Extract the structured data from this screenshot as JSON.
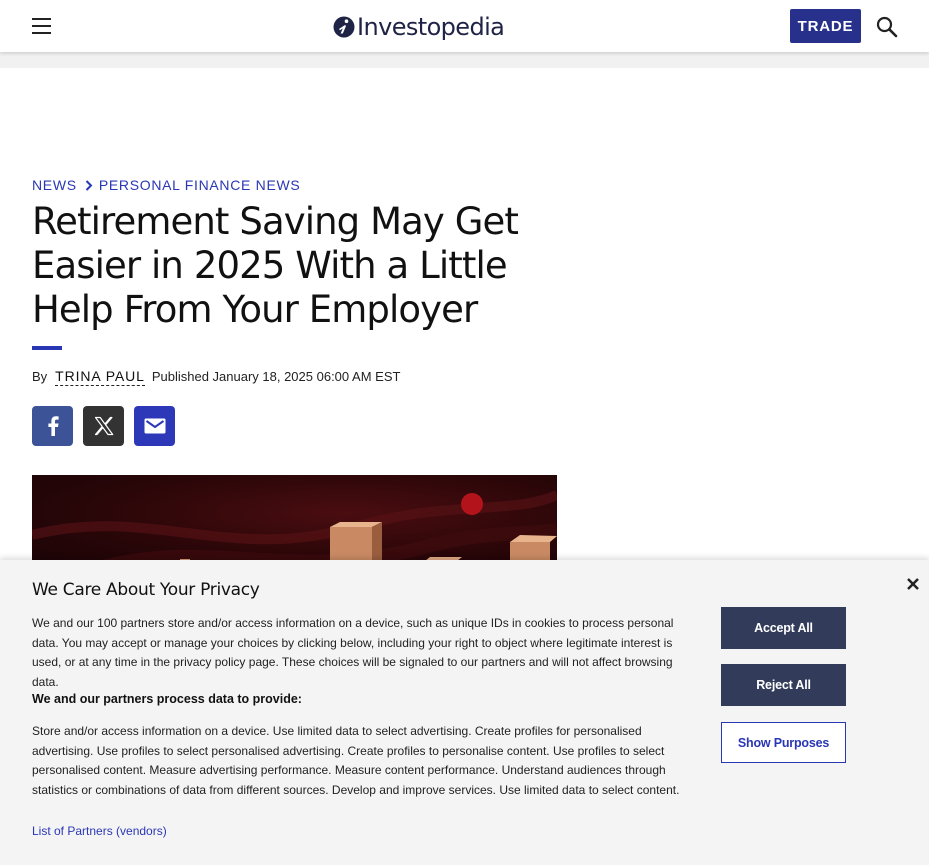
{
  "header": {
    "menu_icon": "hamburger-menu-icon",
    "logo_text": "Investopedia",
    "logo_icon": "investopedia-i-logo-icon",
    "trade_label": "TRADE",
    "search_icon": "search-icon",
    "brand_color": "#27318b"
  },
  "breadcrumb": {
    "items": [
      "NEWS",
      "PERSONAL FINANCE NEWS"
    ],
    "separator_icon": "chevron-right-icon"
  },
  "article": {
    "title": "Retirement Saving May Get Easier in 2025 With a Little Help From Your Employer",
    "by_label": "By",
    "author": "TRINA PAUL",
    "published": "Published January 18, 2025 06:00 AM EST",
    "accent_color": "#2a37b4"
  },
  "share": {
    "facebook_icon": "facebook-icon",
    "x_icon": "x-twitter-icon",
    "email_icon": "email-icon"
  },
  "consent": {
    "title": "We Care About Your Privacy",
    "body": "We and our 100 partners store and/or access information on a device, such as unique IDs in cookies to process personal data. You may accept or manage your choices by clicking below, including your right to object where legitimate interest is used, or at any time in the privacy policy page. These choices will be signaled to our partners and will not affect browsing data.",
    "subheading": "We and our partners process data to provide:",
    "purposes": "Store and/or access information on a device. Use limited data to select advertising. Create profiles for personalised advertising. Use profiles to select personalised advertising. Create profiles to personalise content. Use profiles to select personalised content. Measure advertising performance. Measure content performance. Understand audiences through statistics or combinations of data from different sources. Develop and improve services. Use limited data to select content.",
    "partners_link": "List of Partners (vendors)",
    "accept_label": "Accept All",
    "reject_label": "Reject All",
    "purposes_label": "Show Purposes",
    "close_icon": "close-icon",
    "button_color": "#323c5a"
  }
}
